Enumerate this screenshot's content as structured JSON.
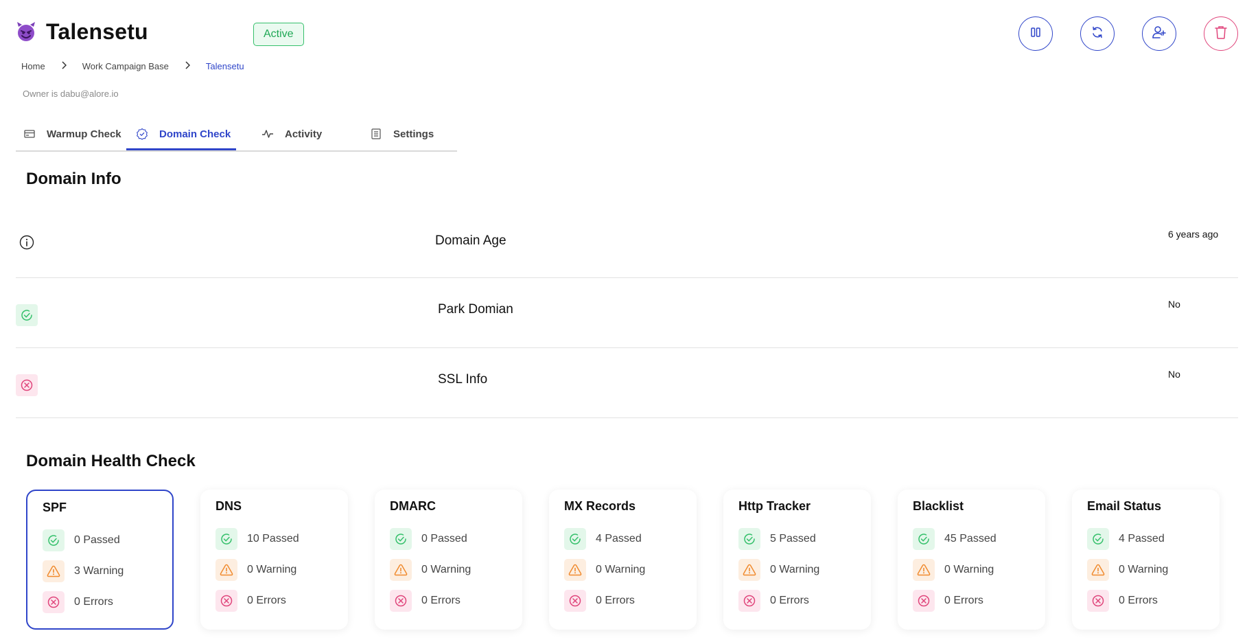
{
  "header": {
    "title": "Talensetu",
    "status": "Active",
    "owner": "Owner is dabu@alore.io",
    "breadcrumb": [
      "Home",
      "Work Campaign Base",
      "Talensetu"
    ]
  },
  "tabs": [
    {
      "label": "Warmup Check",
      "icon": "card-icon"
    },
    {
      "label": "Domain Check",
      "icon": "badge-check-icon",
      "active": true
    },
    {
      "label": "Activity",
      "icon": "activity-icon"
    },
    {
      "label": "Settings",
      "icon": "settings-list-icon"
    }
  ],
  "domain_info": {
    "title": "Domain Info",
    "rows": [
      {
        "label": "Domain Age",
        "value": "6 years ago",
        "icon": "info-icon"
      },
      {
        "label": "Park Domian",
        "value": "No",
        "icon": "check-circle-icon"
      },
      {
        "label": "SSL Info",
        "value": "No",
        "icon": "x-circle-icon"
      }
    ]
  },
  "health": {
    "title": "Domain Health Check",
    "cards": [
      {
        "title": "SPF",
        "passed": "0 Passed",
        "warning": "3 Warning",
        "errors": "0 Errors"
      },
      {
        "title": "DNS",
        "passed": "10 Passed",
        "warning": "0 Warning",
        "errors": "0 Errors"
      },
      {
        "title": "DMARC",
        "passed": "0 Passed",
        "warning": "0 Warning",
        "errors": "0 Errors"
      },
      {
        "title": "MX Records",
        "passed": "4 Passed",
        "warning": "0 Warning",
        "errors": "0 Errors"
      },
      {
        "title": "Http Tracker",
        "passed": "5 Passed",
        "warning": "0 Warning",
        "errors": "0 Errors"
      },
      {
        "title": "Blacklist",
        "passed": "45 Passed",
        "warning": "0 Warning",
        "errors": "0 Errors"
      },
      {
        "title": "Email Status",
        "passed": "4 Passed",
        "warning": "0 Warning",
        "errors": "0 Errors"
      }
    ]
  },
  "colors": {
    "accent": "#2f45c9",
    "success": "#35c06b",
    "warning": "#f08a2d",
    "danger": "#e0457b"
  },
  "header_buttons": [
    "pause-icon",
    "refresh-icon",
    "add-user-icon",
    "trash-icon"
  ]
}
